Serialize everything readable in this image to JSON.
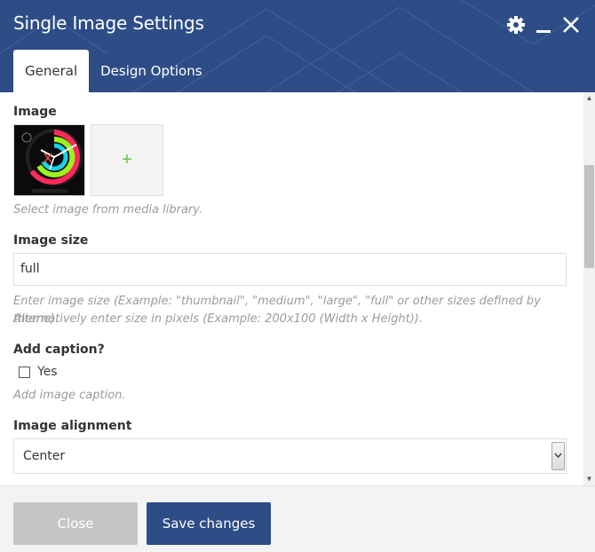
{
  "window": {
    "title": "Single Image Settings",
    "icons": [
      "gear-icon",
      "minimize-icon",
      "close-icon"
    ]
  },
  "tabs": [
    {
      "label": "General",
      "active": true
    },
    {
      "label": "Design Options",
      "active": false
    }
  ],
  "form": {
    "image": {
      "label": "Image",
      "help": "Select image from media library.",
      "add_icon": "plus-icon"
    },
    "image_size": {
      "label": "Image size",
      "value": "full",
      "help_line1": "Enter image size (Example: \"thumbnail\", \"medium\", \"large\", \"full\" or other sizes defined by theme).",
      "help_line2": "Alternatively enter size in pixels (Example: 200x100 (Width x Height))."
    },
    "add_caption": {
      "label": "Add caption?",
      "checkbox_label": "Yes",
      "checked": false,
      "help": "Add image caption."
    },
    "image_alignment": {
      "label": "Image alignment",
      "value": "Center"
    }
  },
  "footer": {
    "close_label": "Close",
    "save_label": "Save changes"
  },
  "colors": {
    "header_bg": "#2e4d87",
    "save_bg": "#2e4d87",
    "close_bg": "#c5c5c5",
    "plus": "#6cc04a"
  }
}
